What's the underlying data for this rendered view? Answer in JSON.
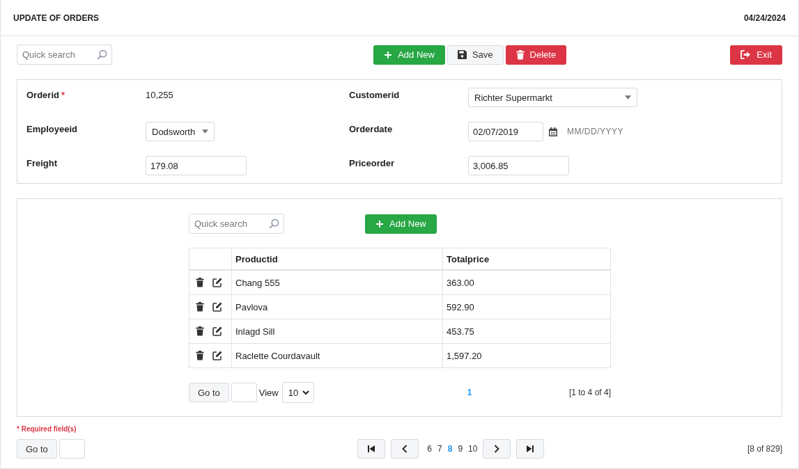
{
  "header": {
    "title": "UPDATE OF ORDERS",
    "date": "04/24/2024"
  },
  "toolbar": {
    "search": {
      "placeholder": "Quick search"
    },
    "buttons": [
      {
        "kind": "add",
        "label": "Add New"
      },
      {
        "kind": "save",
        "label": "Save"
      },
      {
        "kind": "delete",
        "label": "Delete"
      }
    ],
    "exit": {
      "label": "Exit"
    }
  },
  "form": {
    "fields": [
      {
        "label": "Orderid",
        "required_mark": "*",
        "kind": "text",
        "value": "10,255"
      },
      {
        "label": "Customerid",
        "kind": "select",
        "value": "Richter Supermarkt"
      },
      {
        "label": "Employeeid",
        "kind": "select",
        "value": "Dodsworth"
      },
      {
        "label": "Orderdate",
        "kind": "date",
        "value": "02/07/2019",
        "format_hint": "MM/DD/YYYY"
      },
      {
        "label": "Freight",
        "kind": "input",
        "value": "179.08"
      },
      {
        "label": "Priceorder",
        "kind": "input",
        "value": "3,006.85"
      }
    ]
  },
  "details": {
    "search": {
      "placeholder": "Quick search"
    },
    "add_button": "Add New",
    "table": {
      "columns": [
        "Productid",
        "Totalprice"
      ],
      "rows": [
        {
          "product": "Chang 555",
          "total": "363.00"
        },
        {
          "product": "Pavlova",
          "total": "592.90"
        },
        {
          "product": "Inlagd Sill",
          "total": "453.75"
        },
        {
          "product": "Raclette Courdavault",
          "total": "1,597.20"
        }
      ]
    },
    "pager": {
      "goto": "Go to",
      "view_label": "View",
      "page_size": "10",
      "pages": [
        {
          "label": "1",
          "selected": true
        }
      ],
      "summary": "[1 to 4 of 4]"
    }
  },
  "footer": {
    "required_note": "* Required field(s)",
    "goto": "Go to",
    "pages": [
      {
        "label": "6",
        "selected": false
      },
      {
        "label": "7",
        "selected": false
      },
      {
        "label": "8",
        "selected": true
      },
      {
        "label": "9",
        "selected": false
      },
      {
        "label": "10",
        "selected": false
      }
    ],
    "summary": "[8 of 829]"
  }
}
